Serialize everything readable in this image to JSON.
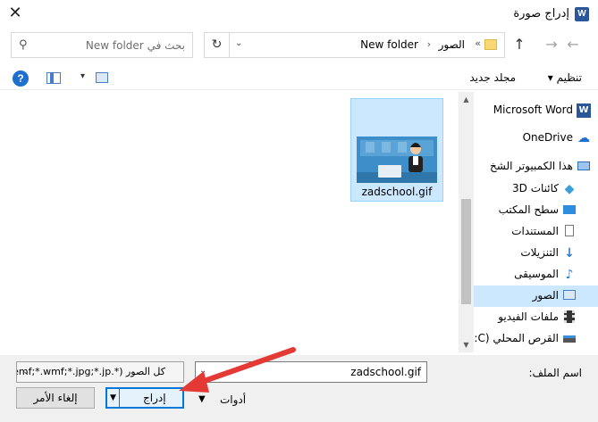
{
  "window": {
    "title": "إدراج صورة",
    "app_badge": "W"
  },
  "navigation": {
    "breadcrumb": [
      "الصور",
      "New folder"
    ],
    "breadcrumb_prefix": "«",
    "separator": "›",
    "search_placeholder": "بحث في New folder"
  },
  "toolbar": {
    "organize": "تنظيم ▾",
    "new_folder": "مجلد جديد",
    "help": "?"
  },
  "nav_pane": {
    "items": [
      {
        "label": "Microsoft Word",
        "icon": "word-icon",
        "level": 1
      },
      {
        "label": "OneDrive",
        "icon": "cloud-icon",
        "level": 1
      },
      {
        "label": "هذا الكمبيوتر الشخ",
        "icon": "computer-icon",
        "level": 1
      },
      {
        "label": "كائنات 3D",
        "icon": "cube-icon",
        "level": 2
      },
      {
        "label": "سطح المكتب",
        "icon": "desktop-icon",
        "level": 2
      },
      {
        "label": "المستندات",
        "icon": "document-icon",
        "level": 2
      },
      {
        "label": "التنزيلات",
        "icon": "download-icon",
        "level": 2
      },
      {
        "label": "الموسيقى",
        "icon": "music-icon",
        "level": 2
      },
      {
        "label": "الصور",
        "icon": "picture-icon",
        "level": 2,
        "selected": true
      },
      {
        "label": "ملفات الفيديو",
        "icon": "video-icon",
        "level": 2
      },
      {
        "label": "القرص المحلي (C:",
        "icon": "drive-icon",
        "level": 2
      }
    ]
  },
  "files": [
    {
      "name": "zadschool.gif",
      "selected": true
    }
  ],
  "bottom": {
    "filename_label": "اسم الملف:",
    "filename_value": "zadschool.gif",
    "filetype_value": "كل الصور (*.emf;*.wmf;*.jpg;*.jp",
    "tools_label": "أدوات",
    "insert_label": "إدراج",
    "cancel_label": "إلغاء الأمر"
  },
  "colors": {
    "selection": "#cce8ff",
    "accent": "#0078d7",
    "annotation_arrow": "#e53935"
  }
}
